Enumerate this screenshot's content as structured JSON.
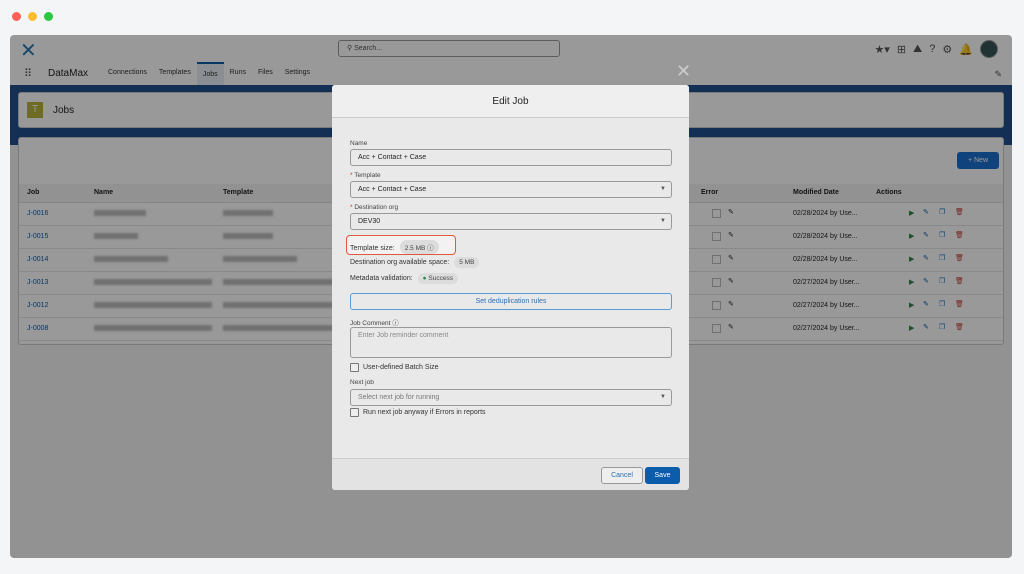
{
  "window": {
    "dots": [
      "#ff5f57",
      "#febc2e",
      "#28c840"
    ]
  },
  "header": {
    "app_name": "DataMax",
    "search_placeholder": "Search...",
    "nav": [
      "Connections",
      "Templates",
      "Jobs",
      "Runs",
      "Files",
      "Settings"
    ],
    "active_nav": "Jobs"
  },
  "page": {
    "title": "Jobs",
    "new_label": "+ New"
  },
  "table": {
    "columns": [
      "Job",
      "Name",
      "Template",
      "Error",
      "Modified Date",
      "Actions"
    ],
    "rows": [
      {
        "job": "J-0016",
        "modified": "02/28/2024 by Use..."
      },
      {
        "job": "J-0015",
        "modified": "02/28/2024 by Use..."
      },
      {
        "job": "J-0014",
        "modified": "02/28/2024 by Use..."
      },
      {
        "job": "J-0013",
        "modified": "02/27/2024 by User..."
      },
      {
        "job": "J-0012",
        "modified": "02/27/2024 by User..."
      },
      {
        "job": "J-0008",
        "modified": "02/27/2024 by User..."
      }
    ]
  },
  "modal": {
    "title": "Edit Job",
    "name_label": "Name",
    "name_value": "Acc + Contact + Case",
    "template_label": "Template",
    "template_value": "Acc + Contact + Case",
    "dest_label": "Destination org",
    "dest_value": "DEV30",
    "template_size_label": "Template size:",
    "template_size_value": "2.5 MB",
    "dest_space_label": "Destination org available space:",
    "dest_space_value": "5 MB",
    "metadata_label": "Metadata validation:",
    "metadata_value": "Success",
    "dedup_label": "Set deduplication rules",
    "comment_label": "Job Comment",
    "comment_placeholder": "Enter Job reminder comment",
    "batch_label": "User-defined Batch Size",
    "next_job_label": "Next job",
    "next_job_placeholder": "Select next job for running",
    "run_anyway_label": "Run next job anyway if Errors in reports",
    "cancel_label": "Cancel",
    "save_label": "Save",
    "req": "*"
  },
  "colors": {
    "accent": "#0b5cab",
    "highlight": "#e0583d",
    "success": "#2e844a"
  }
}
